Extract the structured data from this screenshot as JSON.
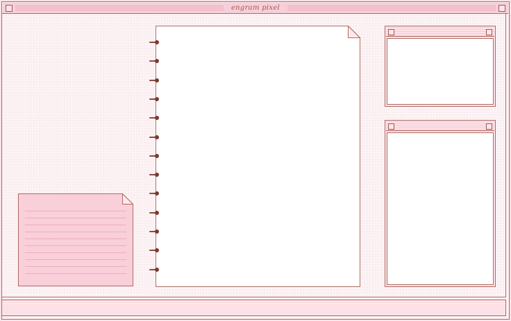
{
  "window": {
    "title": "engram pixel"
  },
  "colors": {
    "border": "#b06b62",
    "pink_light": "#fce4ea",
    "pink_note": "#f9cfd9",
    "page": "#ffffff",
    "ring": "#8a4a3e"
  },
  "icons": {
    "title_left": "window-box-icon",
    "title_right": "window-box-icon"
  },
  "notebook": {
    "ring_count": 13
  }
}
